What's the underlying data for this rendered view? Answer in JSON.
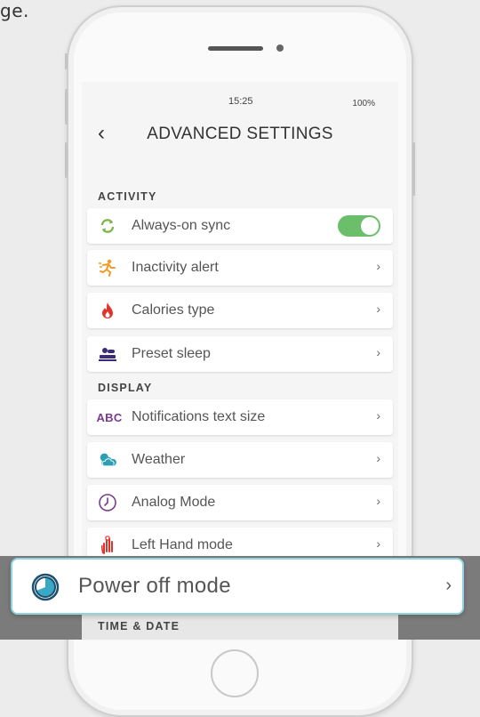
{
  "page_fragment": "ge.",
  "status_bar": {
    "time": "15:25",
    "battery": "100%"
  },
  "nav": {
    "back_label": "‹",
    "title": "ADVANCED SETTINGS"
  },
  "sections": {
    "activity": "ACTIVITY",
    "display": "DISPLAY",
    "time_date": "TIME & DATE"
  },
  "activity_items": [
    {
      "label": "Always-on sync",
      "icon": "sync-icon",
      "control": "toggle",
      "enabled": true
    },
    {
      "label": "Inactivity alert",
      "icon": "running-person-icon",
      "control": "chevron"
    },
    {
      "label": "Calories type",
      "icon": "flame-icon",
      "control": "chevron"
    },
    {
      "label": "Preset sleep",
      "icon": "sleeping-person-icon",
      "control": "chevron"
    }
  ],
  "display_items": [
    {
      "label": "Notifications text size",
      "icon": "abc-icon",
      "icon_text": "ABC",
      "control": "chevron"
    },
    {
      "label": "Weather",
      "icon": "weather-icon",
      "control": "chevron"
    },
    {
      "label": "Analog Mode",
      "icon": "clock-icon",
      "control": "chevron"
    },
    {
      "label": "Left Hand mode",
      "icon": "hand-icon",
      "control": "chevron"
    }
  ],
  "highlight": {
    "label": "Power off mode",
    "icon": "power-off-mode-icon"
  },
  "chevron_glyph": "›",
  "colors": {
    "toggle_on": "#6cbf6a",
    "sync_green": "#7ab648",
    "flame_red": "#e0332b",
    "abc_purple": "#7a3b8d",
    "weather_teal": "#2d9fb5",
    "highlight_border": "#8fd3e0"
  }
}
